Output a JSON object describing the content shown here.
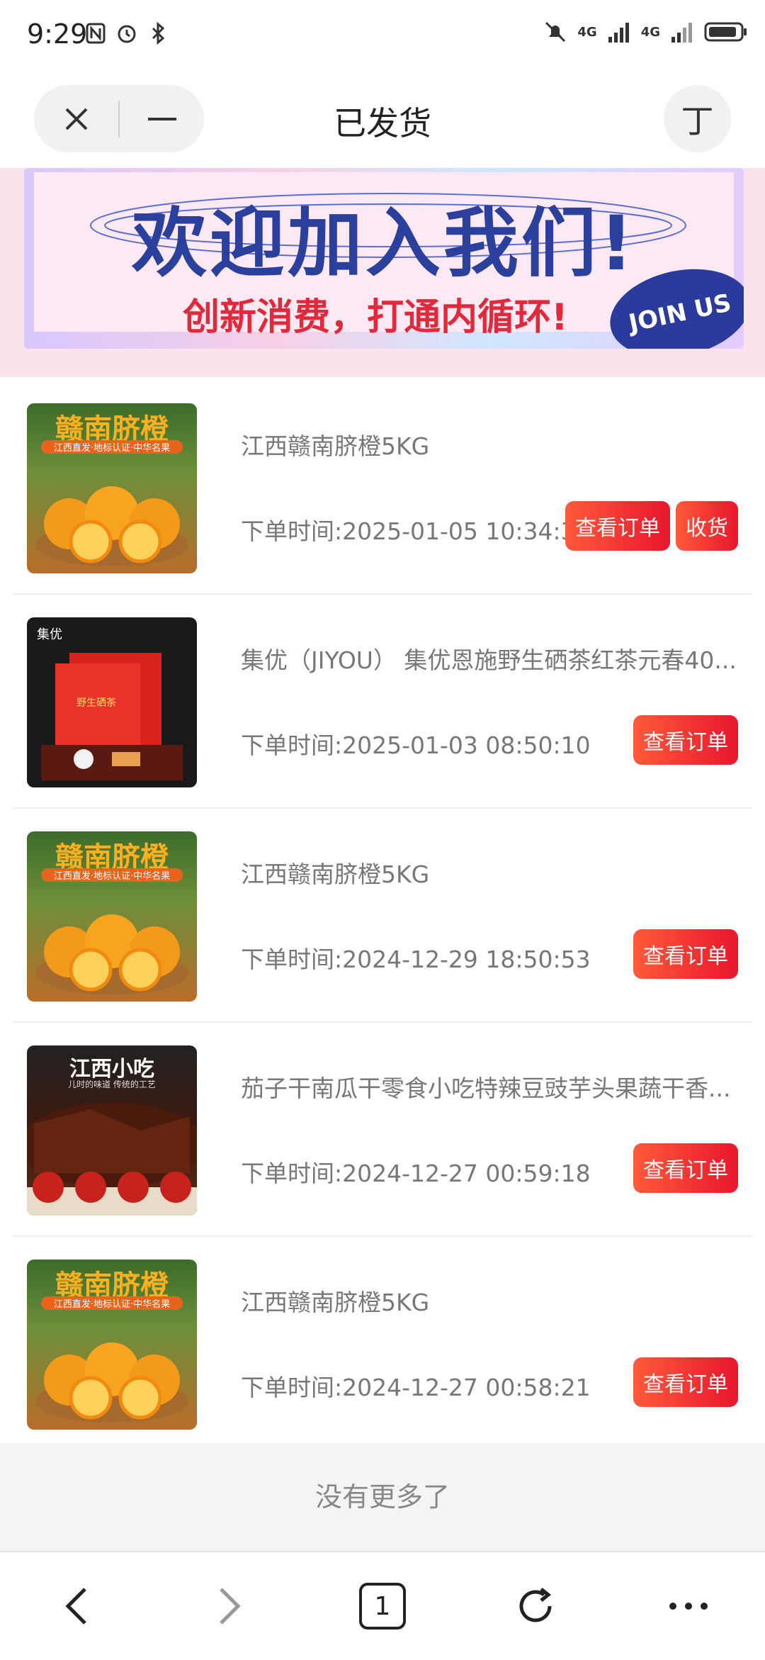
{
  "status_bar": {
    "time": "9:29",
    "network1": "4G",
    "network2": "4G"
  },
  "header": {
    "title": "已发货",
    "font_button_label": "丁"
  },
  "banner": {
    "title": "欢迎加入我们!",
    "subtitle": "创新消费，打通内循环!",
    "badge": "JOIN US"
  },
  "orders": [
    {
      "title": "江西赣南脐橙5KG",
      "time": "下单时间:2025-01-05 10:34:39",
      "buttons": [
        "查看订单",
        "收货"
      ],
      "thumb": {
        "label": "赣南脐橙",
        "tagline": "江西直发·地标认证·中华名果"
      }
    },
    {
      "title": "集优（JIYOU） 集优恩施野生硒茶红茶元春40...",
      "time": "下单时间:2025-01-03 08:50:10",
      "buttons": [
        "查看订单"
      ],
      "thumb": {
        "label": "集优",
        "tagline": "野生硒茶"
      }
    },
    {
      "title": "江西赣南脐橙5KG",
      "time": "下单时间:2024-12-29 18:50:53",
      "buttons": [
        "查看订单"
      ],
      "thumb": {
        "label": "赣南脐橙",
        "tagline": "江西直发·地标认证·中华名果"
      }
    },
    {
      "title": "茄子干南瓜干零食小吃特辣豆豉芋头果蔬干香...",
      "time": "下单时间:2024-12-27 00:59:18",
      "buttons": [
        "查看订单"
      ],
      "thumb": {
        "label": "江西小吃",
        "tagline": "儿时的味道 传统的工艺"
      }
    },
    {
      "title": "江西赣南脐橙5KG",
      "time": "下单时间:2024-12-27 00:58:21",
      "buttons": [
        "查看订单"
      ],
      "thumb": {
        "label": "赣南脐橙",
        "tagline": "江西直发·地标认证·中华名果"
      }
    }
  ],
  "footer": {
    "no_more": "没有更多了"
  },
  "bottom_nav": {
    "tab_count": "1"
  },
  "colors": {
    "button_start": "#ff5a3a",
    "button_end": "#e8162d",
    "banner_title": "#2b3f9c",
    "banner_sub": "#e02a3c"
  }
}
